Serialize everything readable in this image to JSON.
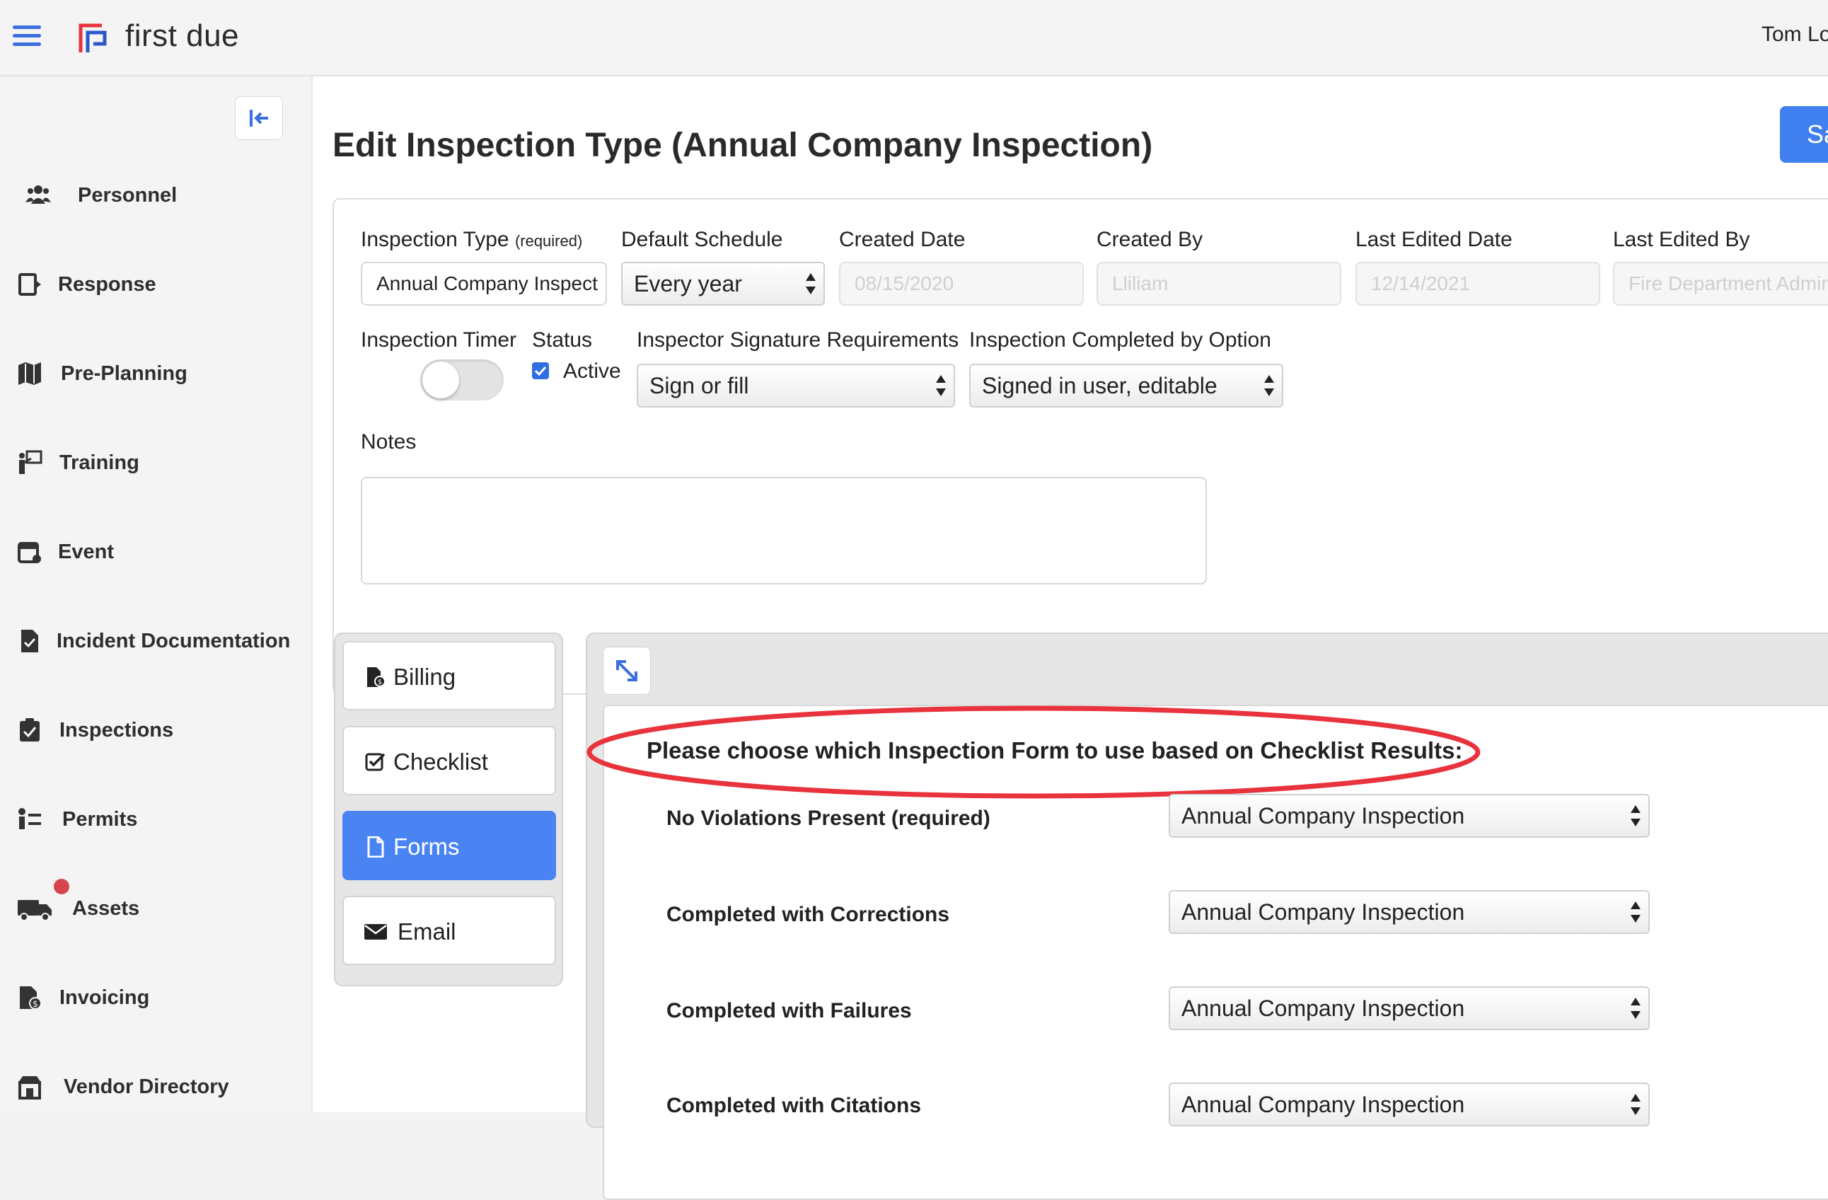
{
  "app": {
    "brand": "first due",
    "user_name": "Tom Lo"
  },
  "sidebar": {
    "items": [
      {
        "label": "Personnel",
        "icon": "people-icon"
      },
      {
        "label": "Response",
        "icon": "response-icon"
      },
      {
        "label": "Pre-Planning",
        "icon": "map-icon"
      },
      {
        "label": "Training",
        "icon": "training-icon"
      },
      {
        "label": "Event",
        "icon": "calendar-icon"
      },
      {
        "label": "Incident Documentation",
        "icon": "document-check-icon"
      },
      {
        "label": "Inspections",
        "icon": "clipboard-check-icon"
      },
      {
        "label": "Permits",
        "icon": "permit-list-icon"
      },
      {
        "label": "Assets",
        "icon": "truck-icon"
      },
      {
        "label": "Invoicing",
        "icon": "invoice-icon"
      },
      {
        "label": "Vendor Directory",
        "icon": "store-icon"
      }
    ]
  },
  "page": {
    "title": "Edit Inspection Type (Annual Company Inspection)",
    "save_label": "Sa"
  },
  "form": {
    "inspection_type_label": "Inspection Type",
    "required_hint": "(required)",
    "inspection_type_value": "Annual Company Inspect",
    "default_schedule_label": "Default Schedule",
    "default_schedule_value": "Every year",
    "created_date_label": "Created Date",
    "created_date_value": "08/15/2020",
    "created_by_label": "Created By",
    "created_by_value": "Lliliam",
    "last_edited_date_label": "Last Edited Date",
    "last_edited_date_value": "12/14/2021",
    "last_edited_by_label": "Last Edited By",
    "last_edited_by_value": "Fire Department Admin",
    "inspection_timer_label": "Inspection Timer",
    "inspection_timer_on": false,
    "status_label": "Status",
    "status_active_label": "Active",
    "status_active_checked": true,
    "signature_label": "Inspector Signature Requirements",
    "signature_value": "Sign or fill",
    "completed_by_label": "Inspection Completed by Option",
    "completed_by_value": "Signed in user, editable",
    "notes_label": "Notes",
    "notes_value": ""
  },
  "tabs": [
    {
      "label": "Billing",
      "icon": "billing-icon",
      "active": false
    },
    {
      "label": "Checklist",
      "icon": "checklist-icon",
      "active": false
    },
    {
      "label": "Forms",
      "icon": "file-icon",
      "active": true
    },
    {
      "label": "Email",
      "icon": "envelope-icon",
      "active": false
    }
  ],
  "forms_panel": {
    "heading": "Please choose which Inspection Form to use based on Checklist Results:",
    "rows": [
      {
        "label": "No Violations Present (required)",
        "value": "Annual Company Inspection"
      },
      {
        "label": "Completed with Corrections",
        "value": "Annual Company Inspection"
      },
      {
        "label": "Completed with Failures",
        "value": "Annual Company Inspection"
      },
      {
        "label": "Completed with Citations",
        "value": "Annual Company Inspection"
      }
    ]
  },
  "colors": {
    "accent": "#4a84f2",
    "annotation_oval": "#e8333d",
    "badge": "#d64550"
  }
}
